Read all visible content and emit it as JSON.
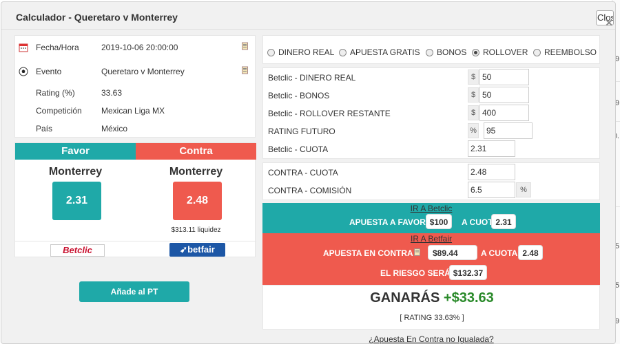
{
  "dialog": {
    "title": "Calculador - Queretaro v Monterrey",
    "close_label": "Close"
  },
  "info": {
    "fecha_label": "Fecha/Hora",
    "fecha_value": "2019-10-06 20:00:00",
    "evento_label": "Evento",
    "evento_value": "Queretaro v Monterrey",
    "rating_label": "Rating (%)",
    "rating_value": "33.63",
    "competicion_label": "Competición",
    "competicion_value": "Mexican Liga MX",
    "pais_label": "País",
    "pais_value": "México"
  },
  "favor": {
    "header": "Favor",
    "team": "Monterrey",
    "odds": "2.31",
    "bookmaker": "Betclic",
    "color": "#1fa9a8"
  },
  "contra": {
    "header": "Contra",
    "team": "Monterrey",
    "odds": "2.48",
    "liquidity": "$313.11 liquidez",
    "exchange": "betfair",
    "color": "#ef5a4e"
  },
  "add_button": "Añade al PT",
  "modes": [
    {
      "label": "DINERO REAL",
      "selected": false
    },
    {
      "label": "APUESTA GRATIS",
      "selected": false
    },
    {
      "label": "BONOS",
      "selected": false
    },
    {
      "label": "ROLLOVER",
      "selected": true
    },
    {
      "label": "REEMBOLSO",
      "selected": false
    }
  ],
  "fields": {
    "dinero_real": {
      "label": "Betclic - DINERO REAL",
      "sign": "$",
      "value": "50"
    },
    "bonos": {
      "label": "Betclic - BONOS",
      "sign": "$",
      "value": "50"
    },
    "rollover": {
      "label": "Betclic - ROLLOVER RESTANTE",
      "sign": "$",
      "value": "400"
    },
    "rating_futuro": {
      "label": "RATING FUTURO",
      "sign": "%",
      "value": "95"
    },
    "cuota": {
      "label": "Betclic - CUOTA",
      "value": "2.31"
    },
    "contra_cuota": {
      "label": "CONTRA - CUOTA",
      "value": "2.48"
    },
    "contra_comision": {
      "label": "CONTRA - COMISIÓN",
      "value": "6.5",
      "sign": "%"
    }
  },
  "back_bar": {
    "link": "IR A Betclic",
    "text1": "APUESTA A FAVOR",
    "stake": "$100",
    "text2": "A CUOTA",
    "odds": "2.31"
  },
  "lay_bar": {
    "link": "IR A Betfair",
    "text1": "APUESTA EN CONTRA",
    "stake": "$89.44",
    "text2": "A CUOTA",
    "odds": "2.48",
    "risk_text": "EL RIESGO SERÁ",
    "risk": "$132.37"
  },
  "result": {
    "label": "GANARÁS",
    "amount": "+$33.63",
    "rating": "[ RATING 33.63% ]"
  },
  "unmatched_link": "¿Apuesta En Contra no Igualada?",
  "background_edge": [
    "9",
    "9",
    "0.",
    "5",
    "5",
    "9"
  ]
}
